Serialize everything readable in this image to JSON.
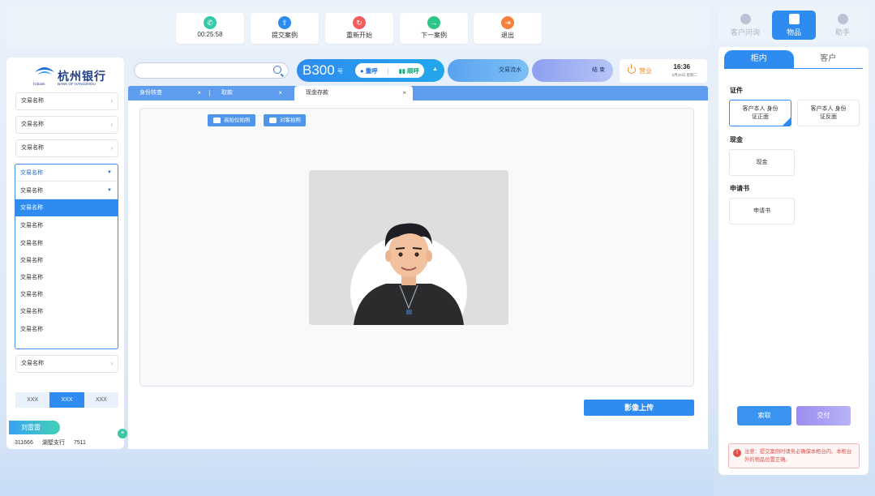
{
  "toolbar": {
    "items": [
      {
        "label": "00:25:58",
        "icon": "phone-timer-icon",
        "color": "#34c9a7"
      },
      {
        "label": "提交案例",
        "icon": "submit-case-icon",
        "color": "#2e8cf0"
      },
      {
        "label": "重新开始",
        "icon": "restart-icon",
        "color": "#f25d5d"
      },
      {
        "label": "下一案例",
        "icon": "next-case-icon",
        "color": "#2fc58a"
      },
      {
        "label": "退出",
        "icon": "exit-icon",
        "color": "#f5823b"
      }
    ]
  },
  "right_tabs": [
    {
      "label": "客户问询",
      "active": false
    },
    {
      "label": "物品",
      "active": true
    },
    {
      "label": "助手",
      "active": false
    }
  ],
  "bank": {
    "name": "杭州银行",
    "short": "hzbank",
    "english": "BANK OF HANGZHOU"
  },
  "sidebar": {
    "items_top": [
      "交易名称",
      "交易名称",
      "交易名称"
    ],
    "dropdown_head": [
      "交易名称",
      "交易名称"
    ],
    "dropdown_options": [
      "交易名称",
      "交易名称",
      "交易名称",
      "交易名称",
      "交易名称",
      "交易名称",
      "交易名称",
      "交易名称"
    ],
    "selected_option_index": 0,
    "item_bottom": "交易名称",
    "segments": [
      "XXX",
      "XXX",
      "XXX"
    ],
    "segment_active": 1,
    "teller": {
      "name": "刘雷雷",
      "id": "311666",
      "branch": "湖墅支行",
      "code": "7511"
    }
  },
  "header": {
    "search_placeholder": "",
    "queue_number": "B300",
    "queue_unit": "号",
    "repeat_call": "重呼",
    "next_call": "顺呼",
    "flow_label": "交易流水",
    "end_label": "结 束",
    "status": "营业",
    "time": "16:36",
    "date": "5月25日 星期二"
  },
  "tabs": [
    {
      "label": "身份核查",
      "active": false
    },
    {
      "label": "取款",
      "active": false
    },
    {
      "label": "现金存款",
      "active": true
    }
  ],
  "capture": {
    "high_camera": "高拍仪拍照",
    "face_camera": "对客拍照",
    "upload": "影像上传"
  },
  "items_panel": {
    "tabs": [
      {
        "label": "柜内",
        "active": true
      },
      {
        "label": "客户",
        "active": false
      }
    ],
    "sections": [
      {
        "title": "证件",
        "cards": [
          {
            "label": "客户本人 身份证正面",
            "selected": true
          },
          {
            "label": "客户本人 身份证反面",
            "selected": false
          }
        ]
      },
      {
        "title": "现金",
        "cards": [
          {
            "label": "现金",
            "selected": false
          }
        ]
      },
      {
        "title": "申请书",
        "cards": [
          {
            "label": "申请书",
            "selected": false
          }
        ]
      }
    ],
    "fetch_btn": "索取",
    "deliver_btn": "交付",
    "notice": "注意：提交案例时请务必确保本柜台内、本柜台外的物品位置正确。"
  }
}
